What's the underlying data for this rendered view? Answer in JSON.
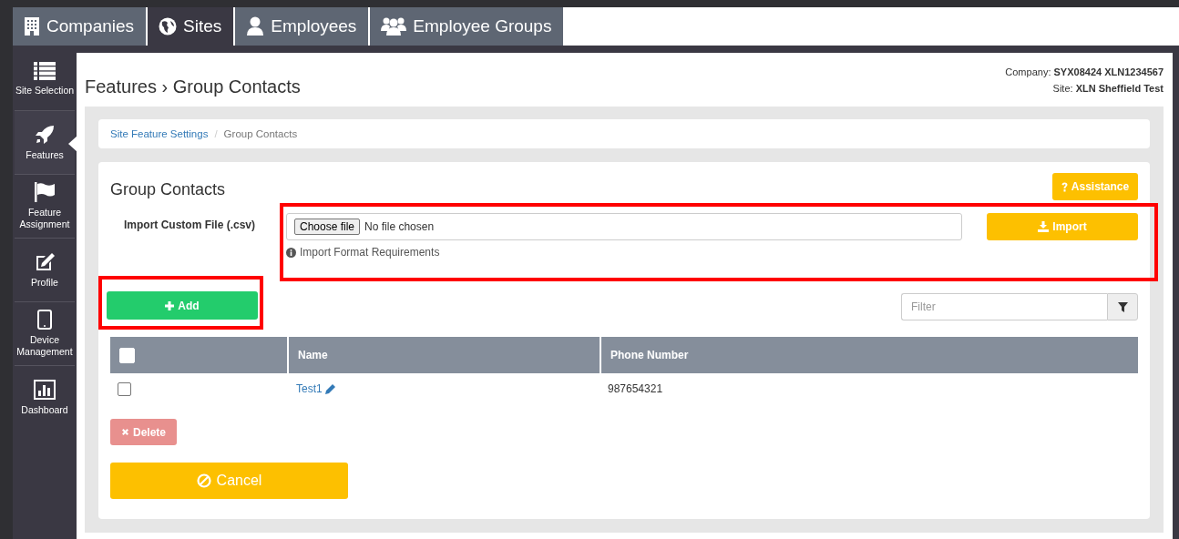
{
  "tabs": [
    {
      "label": "Companies",
      "selected": false
    },
    {
      "label": "Sites",
      "selected": true
    },
    {
      "label": "Employees",
      "selected": false
    },
    {
      "label": "Employee Groups",
      "selected": false
    }
  ],
  "sidebar": {
    "items": [
      {
        "label": "Site Selection",
        "selected": false
      },
      {
        "label": "Features",
        "selected": true
      },
      {
        "label": "Feature Assignment",
        "selected": false
      },
      {
        "label": "Profile",
        "selected": false
      },
      {
        "label": "Device Management",
        "selected": false
      },
      {
        "label": "Dashboard",
        "selected": false
      }
    ]
  },
  "header": {
    "title": "Features › Group Contacts",
    "company_label": "Company:",
    "company": "SYX08424 XLN1234567",
    "site_label": "Site:",
    "site": "XLN Sheffield Test"
  },
  "breadcrumb": [
    {
      "label": "Site Feature Settings",
      "kind": "link"
    },
    {
      "label": "Group Contacts",
      "kind": "current",
      "separator": "/"
    }
  ],
  "panel": {
    "title": "Group Contacts",
    "assistance_button": "Assistance"
  },
  "import": {
    "label": "Import Custom File (.csv)",
    "choose_button": "Choose file",
    "file_status": "No file chosen",
    "help_link": "Import Format Requirements",
    "import_button": "Import",
    "highlighted": true
  },
  "add": {
    "button": "Add",
    "highlighted": true
  },
  "filter": {
    "placeholder": "Filter"
  },
  "table": {
    "columns": [
      "Name",
      "Phone Number"
    ],
    "header_checkbox": {
      "checked": false
    },
    "rows": [
      {
        "checked": false,
        "name": "Test1",
        "phone": "987654321"
      }
    ]
  },
  "delete_button": {
    "label": "Delete",
    "disabled": true
  },
  "cancel_button": {
    "label": "Cancel"
  }
}
